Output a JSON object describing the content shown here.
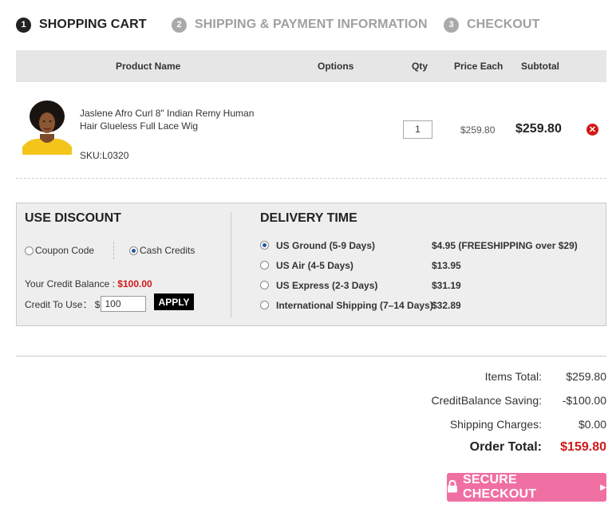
{
  "steps": [
    {
      "num": "1",
      "label": "SHOPPING CART"
    },
    {
      "num": "2",
      "label": "SHIPPING & PAYMENT INFORMATION"
    },
    {
      "num": "3",
      "label": "CHECKOUT"
    }
  ],
  "cart": {
    "headers": {
      "product_name": "Product Name",
      "options": "Options",
      "qty": "Qty",
      "price_each": "Price Each",
      "subtotal": "Subtotal"
    },
    "items": [
      {
        "name": "Jaslene Afro Curl 8\" Indian Remy Human Hair Glueless Full Lace Wig",
        "sku": "SKU:L0320",
        "qty": "1",
        "price_each": "$259.80",
        "subtotal": "$259.80"
      }
    ]
  },
  "discount": {
    "title": "USE DISCOUNT",
    "coupon_label": "Coupon Code",
    "cash_label": "Cash Credits",
    "selected": "cash",
    "credit_balance_label": "Your Credit Balance : ",
    "credit_balance_value": "$100.00",
    "credit_use_label": "Credit To Use： $",
    "credit_use_value": "100",
    "apply_label": "APPLY"
  },
  "delivery": {
    "title": "DELIVERY TIME",
    "options": [
      {
        "name": "US Ground (5-9 Days)",
        "price": "$4.95 (FREESHIPPING over $29)",
        "selected": true
      },
      {
        "name": "US Air (4-5 Days)",
        "price": "$13.95",
        "selected": false
      },
      {
        "name": "US Express (2-3 Days)",
        "price": "$31.19",
        "selected": false
      },
      {
        "name": "International Shipping (7–14 Days)",
        "price": "$32.89",
        "selected": false
      }
    ]
  },
  "totals": {
    "items_total_label": "Items Total:",
    "items_total_value": "$259.80",
    "credit_saving_label": "CreditBalance Saving:",
    "credit_saving_value": "-$100.00",
    "shipping_label": "Shipping Charges:",
    "shipping_value": "$0.00",
    "order_total_label": "Order Total:",
    "order_total_value": "$159.80"
  },
  "checkout_button": {
    "label": "SECURE CHECKOUT"
  },
  "colors": {
    "accent_red": "#d01818",
    "checkout_pink": "#f06fa3",
    "radio_blue": "#1f5aa6"
  }
}
